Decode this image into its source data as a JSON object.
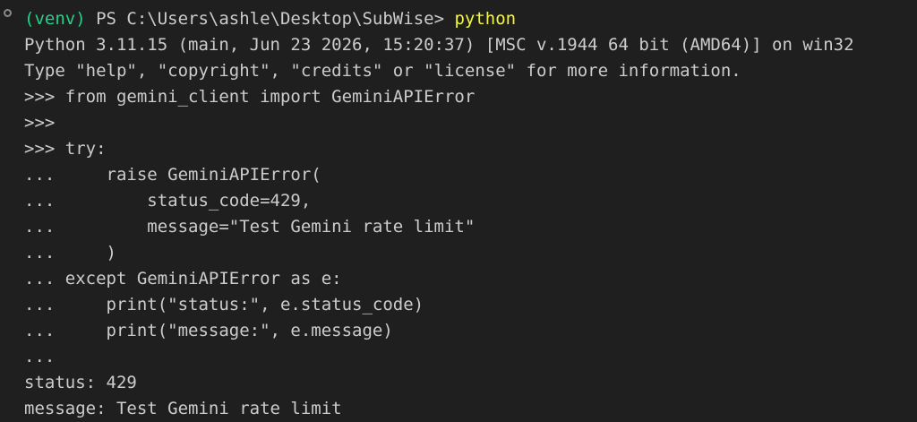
{
  "terminal": {
    "prompt": {
      "venv": "(venv)",
      "ps": " PS C:\\Users\\ashle\\Desktop\\SubWise> ",
      "command": "python"
    },
    "lines": [
      "Python 3.11.15 (main, Jun 23 2026, 15:20:37) [MSC v.1944 64 bit (AMD64)] on win32",
      "Type \"help\", \"copyright\", \"credits\" or \"license\" for more information.",
      ">>> from gemini_client import GeminiAPIError",
      ">>>",
      ">>> try:",
      "...     raise GeminiAPIError(",
      "...         status_code=429,",
      "...         message=\"Test Gemini rate limit\"",
      "...     )",
      "... except GeminiAPIError as e:",
      "...     print(\"status:\", e.status_code)",
      "...     print(\"message:\", e.message)",
      "...",
      "status: 429",
      "message: Test Gemini rate limit"
    ]
  },
  "colors": {
    "background": "#1f1f1f",
    "text": "#cccccc",
    "venv": "#23d18b",
    "command": "#f5f543"
  },
  "icons": {
    "gutter": "circle-status-icon"
  }
}
